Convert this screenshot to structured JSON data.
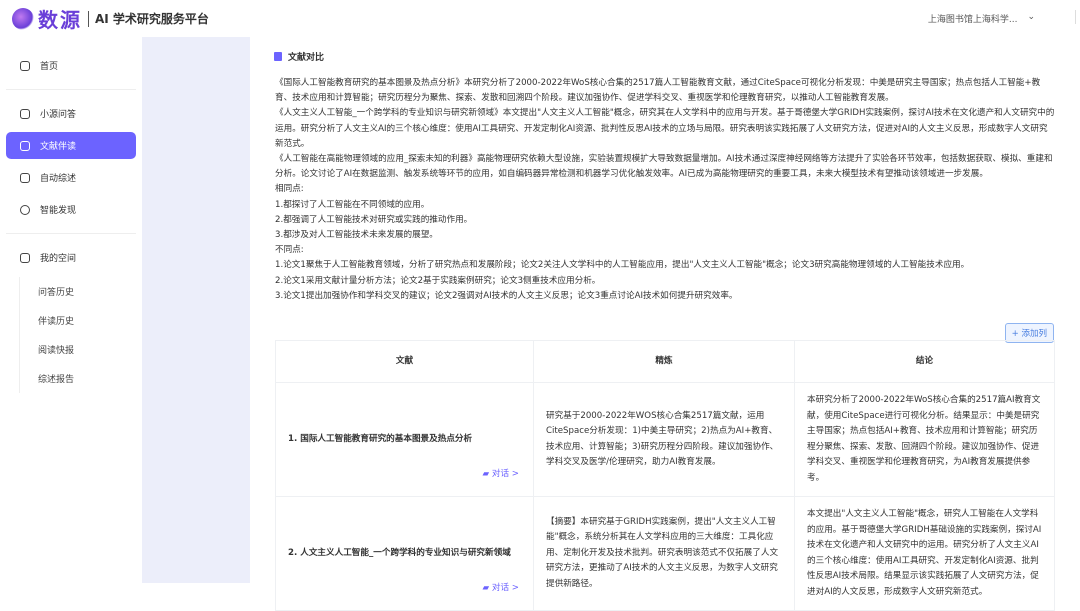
{
  "header": {
    "logo": "数源",
    "subtitle": "AI 学术研究服务平台",
    "org": "上海图书馆上海科学...",
    "chevron": "⌄"
  },
  "sidebar": {
    "items": [
      {
        "label": "首页"
      },
      {
        "label": "小源问答"
      },
      {
        "label": "文献伴读"
      },
      {
        "label": "自动综述"
      },
      {
        "label": "智能发现"
      }
    ],
    "space": "我的空间",
    "sub": [
      "问答历史",
      "伴读历史",
      "阅读快报",
      "综述报告"
    ]
  },
  "main": {
    "title": "文献对比",
    "paragraphs": [
      "《国际人工智能教育研究的基本图景及热点分析》本研究分析了2000-2022年WoS核心合集的2517篇人工智能教育文献，通过CiteSpace可视化分析发现：中美是研究主导国家；热点包括人工智能+教育、技术应用和计算智能；研究历程分为聚焦、探索、发散和回溯四个阶段。建议加强协作、促进学科交叉、重视医学和伦理教育研究，以推动人工智能教育发展。",
      "《人文主义人工智能_一个跨学科的专业知识与研究新领域》本文提出\"人文主义人工智能\"概念，研究其在人文学科中的应用与开发。基于哥德堡大学GRIDH实践案例，探讨AI技术在文化遗产和人文研究中的运用。研究分析了人文主义AI的三个核心维度：使用AI工具研究、开发定制化AI资源、批判性反思AI技术的立场与局限。研究表明该实践拓展了人文研究方法，促进对AI的人文主义反思，形成数字人文研究新范式。",
      "《人工智能在高能物理领域的应用_探索未知的利器》高能物理研究依赖大型设施，实验装置规模扩大导致数据量增加。AI技术通过深度神经网络等方法提升了实验各环节效率，包括数据获取、模拟、重建和分析。论文讨论了AI在数据监测、触发系统等环节的应用，如自编码器异常检测和机器学习优化触发效率。AI已成为高能物理研究的重要工具，未来大模型技术有望推动该领域进一步发展。",
      "相同点:",
      "1.都探讨了人工智能在不同领域的应用。",
      "2.都强调了人工智能技术对研究或实践的推动作用。",
      "3.都涉及对人工智能技术未来发展的展望。",
      "不同点:",
      "1.论文1聚焦于人工智能教育领域，分析了研究热点和发展阶段；论文2关注人文学科中的人工智能应用，提出\"人文主义人工智能\"概念；论文3研究高能物理领域的人工智能技术应用。",
      "2.论文1采用文献计量分析方法；论文2基于实践案例研究；论文3侧重技术应用分析。",
      "3.论文1提出加强协作和学科交叉的建议；论文2强调对AI技术的人文主义反思；论文3重点讨论AI技术如何提升研究效率。"
    ],
    "add_column": "+ 添加列",
    "table": {
      "headers": [
        "文献",
        "精炼",
        "结论"
      ],
      "chat_label": "对话 >",
      "rows": [
        {
          "doc": "1. 国际人工智能教育研究的基本图景及热点分析",
          "refine": "研究基于2000-2022年WOS核心合集2517篇文献，运用CiteSpace分析发现：1)中美主导研究；2)热点为AI+教育、技术应用、计算智能；3)研究历程分四阶段。建议加强协作、学科交叉及医学/伦理研究，助力AI教育发展。",
          "conclusion": "本研究分析了2000-2022年WoS核心合集的2517篇AI教育文献，使用CiteSpace进行可视化分析。结果显示：中美是研究主导国家；热点包括AI+教育、技术应用和计算智能；研究历程分聚焦、探索、发散、回溯四个阶段。建议加强协作、促进学科交叉、重视医学和伦理教育研究，为AI教育发展提供参考。"
        },
        {
          "doc": "2. 人文主义人工智能_一个跨学科的专业知识与研究新领域",
          "refine": "【摘要】本研究基于GRIDH实践案例，提出\"人文主义人工智能\"概念，系统分析其在人文学科应用的三大维度：工具化应用、定制化开发及技术批判。研究表明该范式不仅拓展了人文研究方法，更推动了AI技术的人文主义反思，为数字人文研究提供新路径。",
          "conclusion": "本文提出\"人文主义人工智能\"概念，研究人工智能在人文学科的应用。基于哥德堡大学GRIDH基础设施的实践案例，探讨AI技术在文化遗产和人文研究中的运用。研究分析了人文主义AI的三个核心维度：使用AI工具研究、开发定制化AI资源、批判性反思AI技术局限。结果显示该实践拓展了人文研究方法，促进对AI的人文反思，形成数字人文研究新范式。"
        }
      ]
    }
  }
}
